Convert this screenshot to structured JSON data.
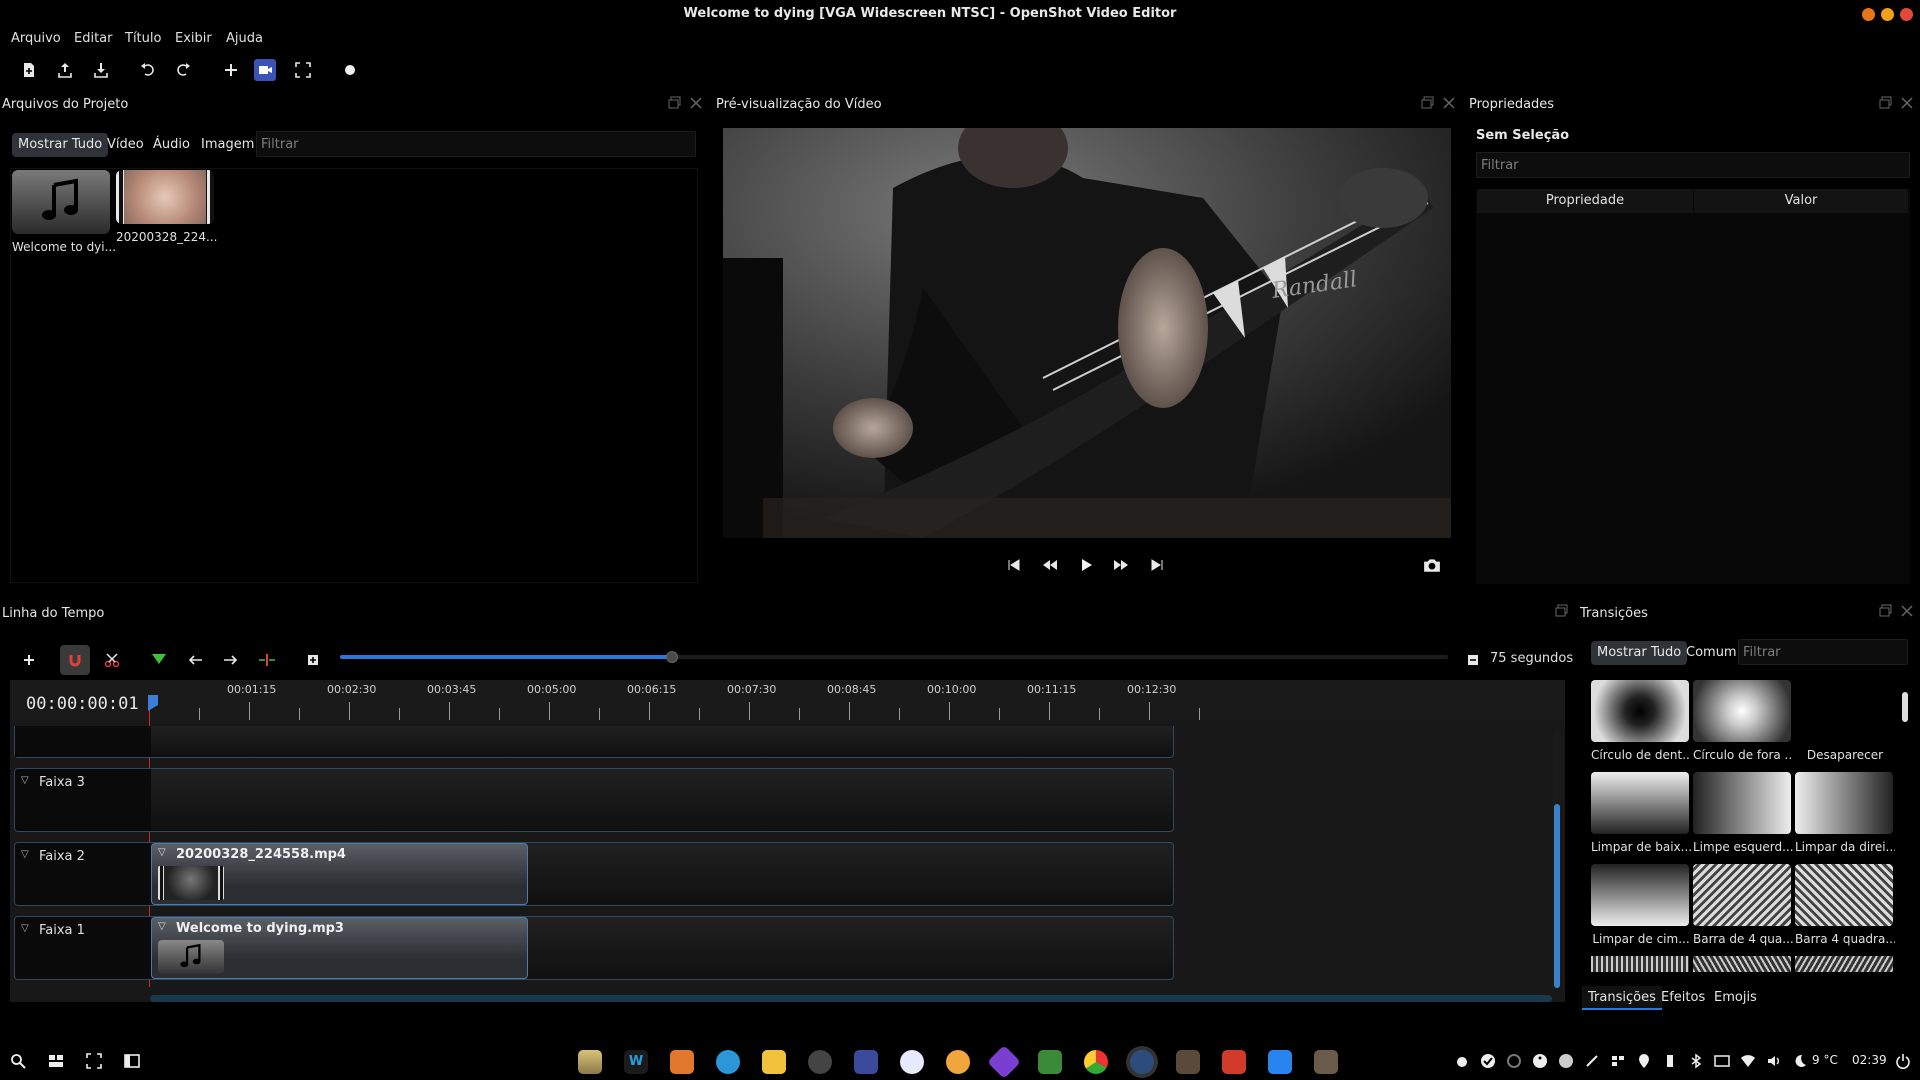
{
  "window": {
    "title": "Welcome to dying [VGA Widescreen NTSC] - OpenShot Video Editor",
    "controls_colors": [
      "#e8751a",
      "#f2a019",
      "#e2473b"
    ]
  },
  "menu": [
    "Arquivo",
    "Editar",
    "Título",
    "Exibir",
    "Ajuda"
  ],
  "toolbar": {
    "icons": [
      "new-project-icon",
      "open-project-icon",
      "save-project-icon",
      "undo-icon",
      "redo-icon",
      "import-files-icon",
      "choose-profile-icon",
      "fullscreen-icon",
      "export-video-icon"
    ]
  },
  "project_files": {
    "header": "Arquivos do Projeto",
    "tabs": [
      "Mostrar Tudo",
      "Vídeo",
      "Áudio",
      "Imagem"
    ],
    "active_tab": "Mostrar Tudo",
    "filter_placeholder": "Filtrar",
    "files": [
      {
        "name": "Welcome to dyi...",
        "kind": "audio"
      },
      {
        "name": "20200328_224...",
        "kind": "video"
      }
    ]
  },
  "preview": {
    "header": "Pré-visualização do Vídeo",
    "controls": [
      "jump-start-icon",
      "rewind-icon",
      "play-icon",
      "fast-forward-icon",
      "jump-end-icon"
    ],
    "snapshot_icon": "camera-icon"
  },
  "properties": {
    "header": "Propriedades",
    "selection": "Sem Seleção",
    "filter_placeholder": "Filtrar",
    "columns": [
      "Propriedade",
      "Valor"
    ]
  },
  "timeline": {
    "header": "Linha do Tempo",
    "timecode": "00:00:00:01",
    "zoom_label": "75 segundos",
    "zoom_fraction": 0.3,
    "ruler_labels": [
      "00:01:15",
      "00:02:30",
      "00:03:45",
      "00:05:00",
      "00:06:15",
      "00:07:30",
      "00:08:45",
      "00:10:00",
      "00:11:15",
      "00:12:30"
    ],
    "tracks": [
      {
        "name": "Faixa 3",
        "clip": ""
      },
      {
        "name": "Faixa 2",
        "clip": "20200328_224558.mp4"
      },
      {
        "name": "Faixa 1",
        "clip": "Welcome to dying.mp3"
      }
    ]
  },
  "transitions": {
    "header": "Transições",
    "tabs": [
      "Mostrar Tudo",
      "Comum"
    ],
    "active_tab": "Mostrar Tudo",
    "filter_placeholder": "Filtrar",
    "items": [
      "Círculo de dent...",
      "Círculo de fora ...",
      "Desaparecer",
      "Limpar de baix...",
      "Limpe esquerd...",
      "Limpar da direi...",
      "Limpar de cim...",
      "Barra de 4 qua...",
      "Barra 4 quadra..."
    ],
    "bottom_tabs": [
      "Transições",
      "Efeitos",
      "Emojis"
    ],
    "active_bottom_tab": "Transições"
  },
  "taskbar": {
    "weather": "9 °C",
    "clock": "02:39"
  }
}
